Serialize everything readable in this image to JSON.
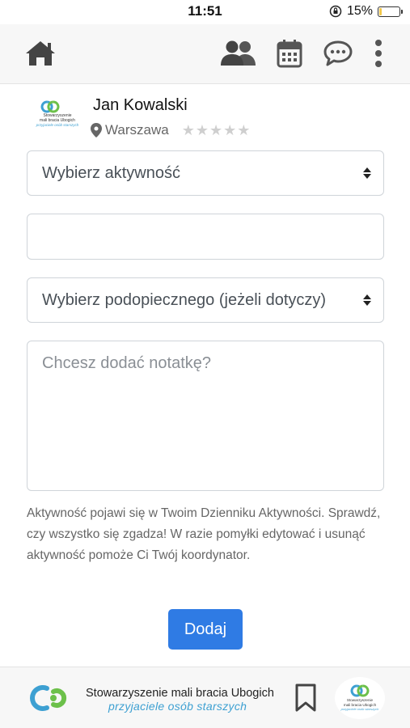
{
  "status_bar": {
    "time": "11:51",
    "battery": "15%",
    "battery_level": 0.15
  },
  "nav": {
    "icons": [
      "home-icon",
      "users-icon",
      "calendar-icon",
      "chat-icon",
      "more-icon"
    ]
  },
  "profile": {
    "name": "Jan Kowalski",
    "location": "Warszawa",
    "rating": 0,
    "rating_max": 5,
    "logo_text": "Stowarzyszenie mali bracia Ubogich",
    "logo_subtext": "przyjaciele osób starszych"
  },
  "form": {
    "activity_select": "Wybierz aktywność",
    "text_input_value": "",
    "ward_select": "Wybierz podopiecznego (jeżeli dotyczy)",
    "note_placeholder": "Chcesz dodać notatkę?",
    "help_text": "Aktywność pojawi się w Twoim Dzienniku Aktywności. Sprawdź, czy wszystko się zgadza! W razie pomyłki edytować i usunąć aktywność pomoże Ci Twój koordynator.",
    "submit_label": "Dodaj"
  },
  "footer": {
    "title": "Stowarzyszenie mali bracia Ubogich",
    "subtitle": "przyjaciele osób starszych"
  },
  "colors": {
    "accent": "#2f7be4",
    "logo_blue": "#3da0d2",
    "logo_green": "#6cc04a"
  }
}
